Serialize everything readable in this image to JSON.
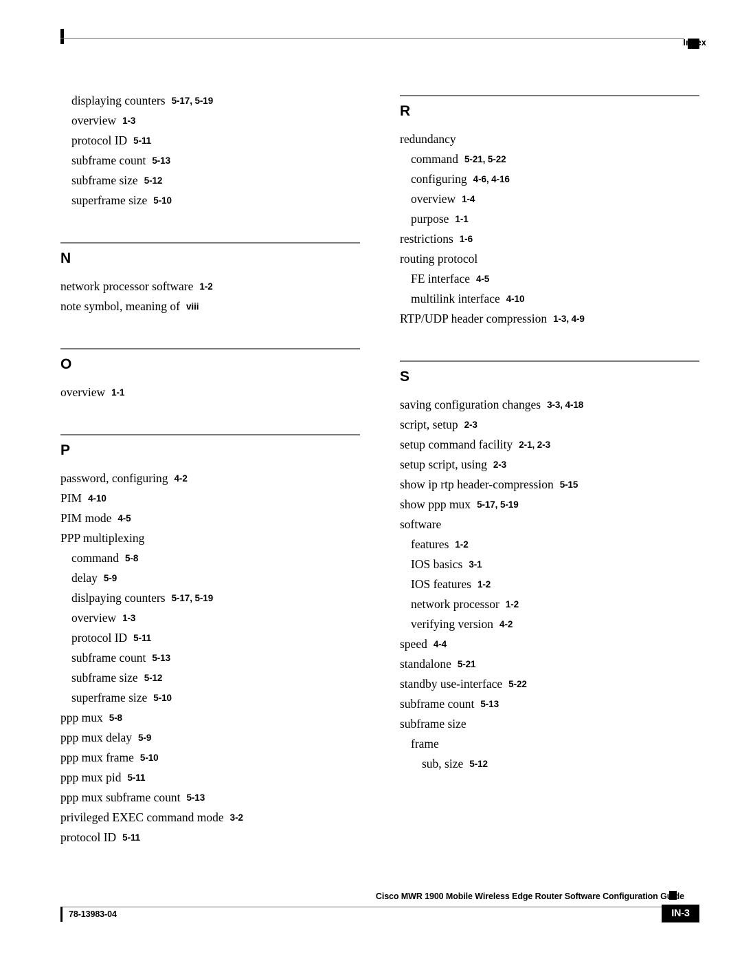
{
  "header": {
    "label": "Index",
    "square_color": "#000000"
  },
  "columns": [
    {
      "name": "left-column",
      "blocks": [
        {
          "type": "entries",
          "leading_gap": 0,
          "entries": [
            {
              "term": "displaying counters",
              "pages": "5-17, 5-19",
              "level": 1
            },
            {
              "term": "overview",
              "pages": "1-3",
              "level": 1
            },
            {
              "term": "protocol ID",
              "pages": "5-11",
              "level": 1
            },
            {
              "term": "subframe count",
              "pages": "5-13",
              "level": 1
            },
            {
              "term": "subframe size",
              "pages": "5-12",
              "level": 1
            },
            {
              "term": "superframe size",
              "pages": "5-10",
              "level": 1
            }
          ]
        },
        {
          "type": "section",
          "letter": "N",
          "entries": [
            {
              "term": "network processor software",
              "pages": "1-2",
              "level": 0
            },
            {
              "term": "note symbol, meaning of",
              "pages": "viii",
              "level": 0
            }
          ]
        },
        {
          "type": "section",
          "letter": "O",
          "entries": [
            {
              "term": "overview",
              "pages": "1-1",
              "level": 0
            }
          ]
        },
        {
          "type": "section",
          "letter": "P",
          "entries": [
            {
              "term": "password, configuring",
              "pages": "4-2",
              "level": 0
            },
            {
              "term": "PIM",
              "pages": "4-10",
              "level": 0
            },
            {
              "term": "PIM mode",
              "pages": "4-5",
              "level": 0
            },
            {
              "term": "PPP multiplexing",
              "pages": "",
              "level": 0
            },
            {
              "term": "command",
              "pages": "5-8",
              "level": 1
            },
            {
              "term": "delay",
              "pages": "5-9",
              "level": 1
            },
            {
              "term": "dislpaying counters",
              "pages": "5-17, 5-19",
              "level": 1
            },
            {
              "term": "overview",
              "pages": "1-3",
              "level": 1
            },
            {
              "term": "protocol ID",
              "pages": "5-11",
              "level": 1
            },
            {
              "term": "subframe count",
              "pages": "5-13",
              "level": 1
            },
            {
              "term": "subframe size",
              "pages": "5-12",
              "level": 1
            },
            {
              "term": "superframe size",
              "pages": "5-10",
              "level": 1
            },
            {
              "term": "ppp mux",
              "pages": "5-8",
              "level": 0
            },
            {
              "term": "ppp mux delay",
              "pages": "5-9",
              "level": 0
            },
            {
              "term": "ppp mux frame",
              "pages": "5-10",
              "level": 0
            },
            {
              "term": "ppp mux pid",
              "pages": "5-11",
              "level": 0
            },
            {
              "term": "ppp mux subframe count",
              "pages": "5-13",
              "level": 0
            },
            {
              "term": "privileged EXEC command mode",
              "pages": "3-2",
              "level": 0
            },
            {
              "term": "protocol ID",
              "pages": "5-11",
              "level": 0
            }
          ]
        }
      ]
    },
    {
      "name": "right-column",
      "blocks": [
        {
          "type": "section",
          "letter": "R",
          "leading_gap": 0,
          "entries": [
            {
              "term": "redundancy",
              "pages": "",
              "level": 0
            },
            {
              "term": "command",
              "pages": "5-21, 5-22",
              "level": 1
            },
            {
              "term": "configuring",
              "pages": "4-6, 4-16",
              "level": 1
            },
            {
              "term": "overview",
              "pages": "1-4",
              "level": 1
            },
            {
              "term": "purpose",
              "pages": "1-1",
              "level": 1
            },
            {
              "term": "restrictions",
              "pages": "1-6",
              "level": 0
            },
            {
              "term": "routing protocol",
              "pages": "",
              "level": 0
            },
            {
              "term": "FE interface",
              "pages": "4-5",
              "level": 1
            },
            {
              "term": "multilink interface",
              "pages": "4-10",
              "level": 1
            },
            {
              "term": "RTP/UDP header compression",
              "pages": "1-3, 4-9",
              "level": 0
            }
          ]
        },
        {
          "type": "section",
          "letter": "S",
          "entries": [
            {
              "term": "saving configuration changes",
              "pages": "3-3, 4-18",
              "level": 0
            },
            {
              "term": "script, setup",
              "pages": "2-3",
              "level": 0
            },
            {
              "term": "setup command facility",
              "pages": "2-1, 2-3",
              "level": 0
            },
            {
              "term": "setup script, using",
              "pages": "2-3",
              "level": 0
            },
            {
              "term": "show ip rtp header-compression",
              "pages": "5-15",
              "level": 0
            },
            {
              "term": "show ppp mux",
              "pages": "5-17, 5-19",
              "level": 0
            },
            {
              "term": "software",
              "pages": "",
              "level": 0
            },
            {
              "term": "features",
              "pages": "1-2",
              "level": 1
            },
            {
              "term": "IOS basics",
              "pages": "3-1",
              "level": 1
            },
            {
              "term": "IOS features",
              "pages": "1-2",
              "level": 1
            },
            {
              "term": "network processor",
              "pages": "1-2",
              "level": 1
            },
            {
              "term": "verifying version",
              "pages": "4-2",
              "level": 1
            },
            {
              "term": "speed",
              "pages": "4-4",
              "level": 0
            },
            {
              "term": "standalone",
              "pages": "5-21",
              "level": 0
            },
            {
              "term": "standby use-interface",
              "pages": "5-22",
              "level": 0
            },
            {
              "term": "subframe count",
              "pages": "5-13",
              "level": 0
            },
            {
              "term": "subframe size",
              "pages": "",
              "level": 0
            },
            {
              "term": "frame",
              "pages": "",
              "level": 1
            },
            {
              "term": "sub, size",
              "pages": "5-12",
              "level": 2
            }
          ]
        }
      ]
    }
  ],
  "footer": {
    "title": "Cisco MWR 1900 Mobile Wireless Edge Router Software Configuration Guide",
    "doc_number": "78-13983-04",
    "page_number": "IN-3"
  }
}
